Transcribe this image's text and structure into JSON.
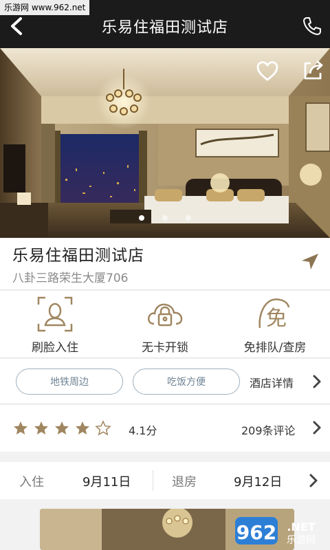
{
  "watermark_top": "乐游网 www.962.net",
  "header": {
    "title": "乐易住福田测试店",
    "back_icon": "back-arrow-icon",
    "phone_icon": "phone-icon"
  },
  "hero": {
    "dots": 3,
    "active_dot": 1,
    "fav_icon": "heart-icon",
    "share_icon": "share-icon"
  },
  "hotel": {
    "name": "乐易住福田测试店",
    "address": "八卦三路荣生大厦706"
  },
  "services": [
    {
      "label": "刷脸入住",
      "icon": "face-scan-icon"
    },
    {
      "label": "无卡开锁",
      "icon": "cloud-lock-icon"
    },
    {
      "label": "免排队/查房",
      "icon": "mian-badge-icon"
    }
  ],
  "tags": [
    "地铁周边",
    "吃饭方便"
  ],
  "details_label": "酒店详情",
  "rating": {
    "stars": 4,
    "max": 5,
    "score": "4.1分",
    "reviews": "209条评论"
  },
  "dates": {
    "checkin_label": "入住",
    "checkin": "9月11日",
    "checkout_label": "退房",
    "checkout": "9月12日"
  },
  "watermark_bottom": {
    "number": "962",
    "suffix": ".NET",
    "site": "乐游网"
  },
  "colors": {
    "header_bg": "#1b1b1b",
    "gold": "#a08660",
    "tag_border": "#9fb0bd",
    "star": "#a08660"
  }
}
